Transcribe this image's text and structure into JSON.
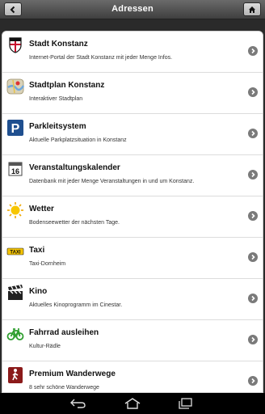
{
  "header": {
    "title": "Adressen",
    "back_icon": "chevron-left-icon",
    "home_icon": "home-icon"
  },
  "items": [
    {
      "name": "Stadt Konstanz",
      "desc": "Internet-Portal der Stadt Konstanz mit jeder Menge Infos.",
      "icon": "city-crest-icon"
    },
    {
      "name": "Stadtplan Konstanz",
      "desc": "Interaktiver Stadtplan",
      "icon": "map-icon"
    },
    {
      "name": "Parkleitsystem",
      "desc": "Aktuelle Parkplatzsituation in Konstanz",
      "icon": "parking-icon"
    },
    {
      "name": "Veranstaltungskalender",
      "desc": "Datenbank mit jeder Menge Veranstaltungen in und um Konstanz.",
      "icon": "calendar-icon",
      "calendar_day": "16"
    },
    {
      "name": "Wetter",
      "desc": "Bodenseewetter der nächsten Tage.",
      "icon": "sun-icon"
    },
    {
      "name": "Taxi",
      "desc": "Taxi-Dornheim",
      "icon": "taxi-icon",
      "taxi_label": "TAXI"
    },
    {
      "name": "Kino",
      "desc": "Aktuelles Kinoprogramm im Cinestar.",
      "icon": "clapperboard-icon"
    },
    {
      "name": "Fahrrad ausleihen",
      "desc": "Kultur-Rädle",
      "icon": "bicycle-icon"
    },
    {
      "name": "Premium Wanderwege",
      "desc": "8 sehr schöne Wanderwege",
      "icon": "hiking-icon"
    }
  ],
  "system_nav": [
    "back-nav-icon",
    "home-nav-icon",
    "recents-nav-icon"
  ],
  "colors": {
    "header_top": "#6a6a6a",
    "header_bottom": "#3f3f3f",
    "arrow": "#7a7a7a",
    "bike_green": "#2e9e2e",
    "parking_blue": "#1f4f8f"
  }
}
